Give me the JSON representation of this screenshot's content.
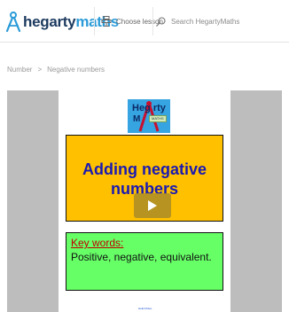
{
  "nav": {
    "brand_part1": "hegarty",
    "brand_part2": "maths",
    "choose_lesson": "Choose lesson",
    "search_placeholder": "Search HegartyMaths",
    "icons": [
      "compass-icon",
      "lesson-stack-icon",
      "search-icon"
    ]
  },
  "breadcrumb": {
    "items": [
      "Number",
      "Negative numbers"
    ],
    "separator": ">"
  },
  "video": {
    "logo_line1": "Heg  rty",
    "logo_line2": "M",
    "logo_tag": "MATHS",
    "title": "Adding negative numbers",
    "keywords_heading": "Key words:",
    "keywords": "Positive, negative, equivalent.",
    "tiny_link": "Hello/Video",
    "play_icon": "play-icon"
  },
  "colors": {
    "brand_dark": "#1c3a5f",
    "brand_accent": "#2b9bd8",
    "title_box": "#ffc000",
    "title_text": "#1a1ab2",
    "keywords_box": "#66ff66",
    "keywords_heading": "#c00000",
    "stage_bg": "#bdbdbd"
  }
}
